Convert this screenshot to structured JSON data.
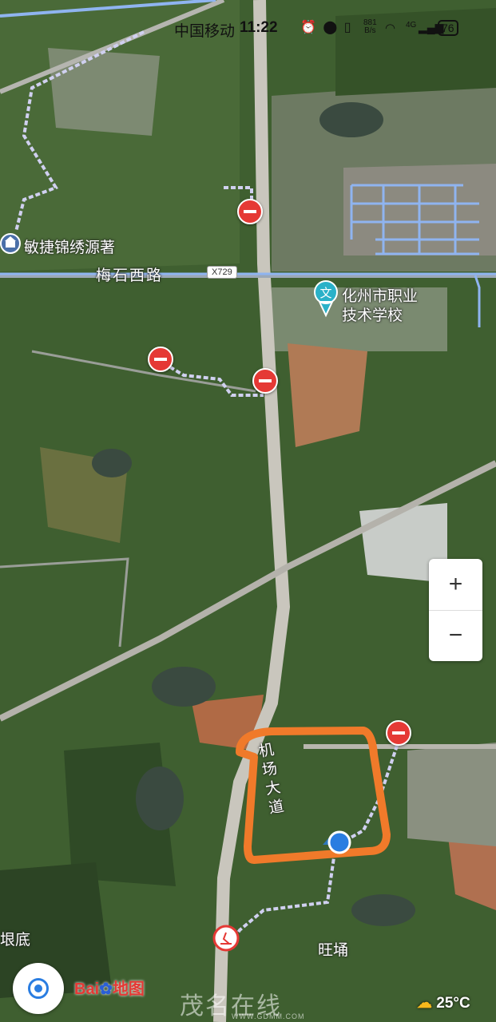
{
  "status_bar": {
    "carrier": "中国移动",
    "time": "11:22",
    "net_speed_value": "881",
    "net_speed_unit": "B/s",
    "signal_label": "4G",
    "battery": "76",
    "icons": [
      "alarm-icon",
      "location-icon",
      "vibrate-icon",
      "wifi-icon",
      "signal-icon"
    ]
  },
  "map": {
    "poi_residence": "敏捷锦绣源著",
    "road_name": "梅石西路",
    "road_shield": "X729",
    "school_line1": "化州市职业",
    "school_line2": "技术学校",
    "school_icon_glyph": "文",
    "road_vertical_name": "机场大道",
    "place_wangyong": "旺埇",
    "place_left_edge": "垠底"
  },
  "controls": {
    "zoom_in": "+",
    "zoom_out": "−"
  },
  "branding": {
    "logo_part1": "Bai",
    "logo_part2": "地图",
    "watermark": "茂名在线",
    "watermark_url": "WWW.GDMM.COM"
  },
  "weather": {
    "temperature": "25°C"
  },
  "colors": {
    "route_blue": "#8fb4f0",
    "noentry_red": "#e53935",
    "highlight_orange": "#f07a2a",
    "location_blue": "#2a7de1"
  }
}
